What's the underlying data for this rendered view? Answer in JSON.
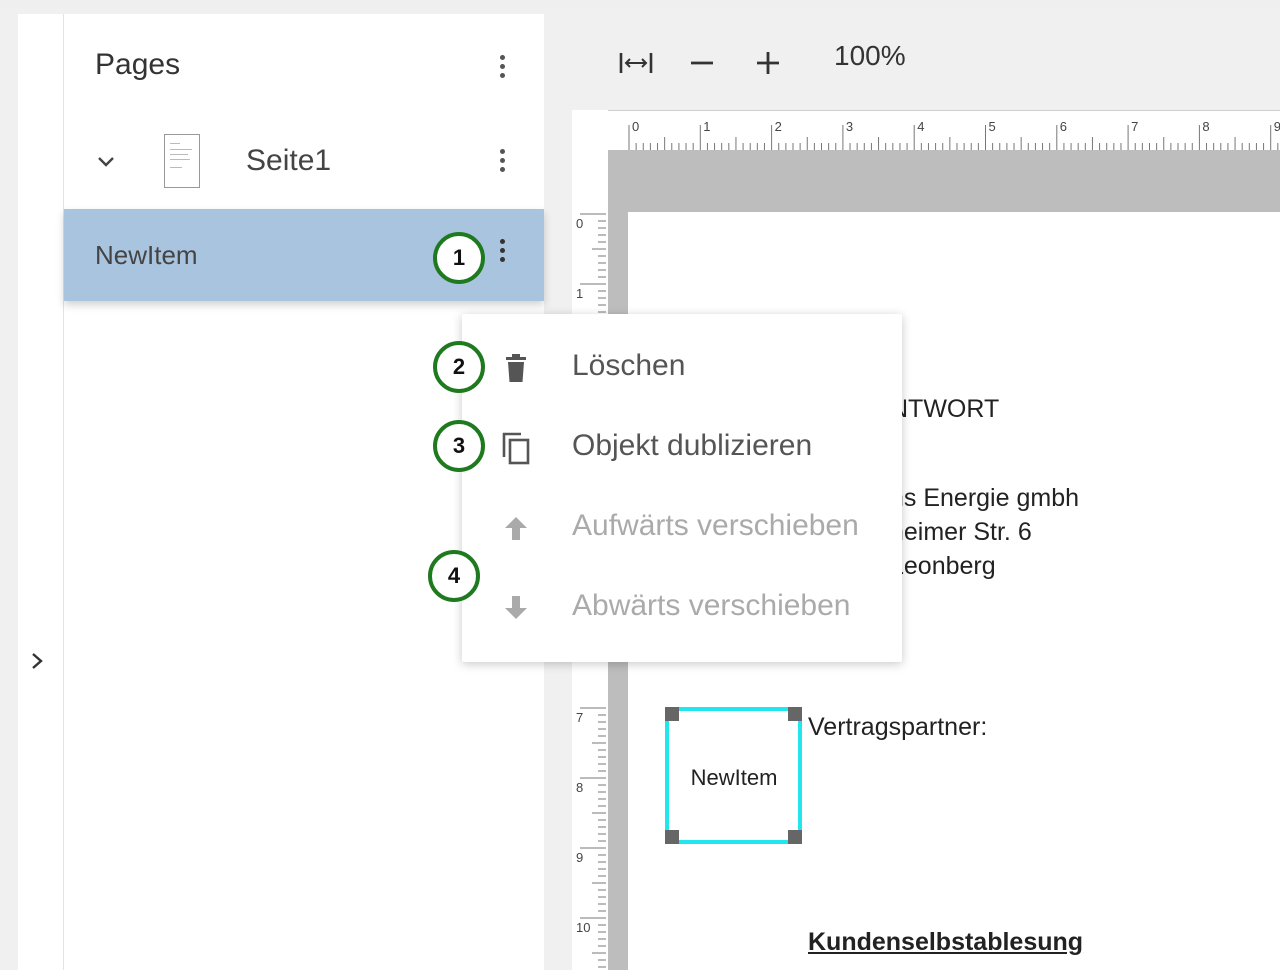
{
  "pages_panel": {
    "title": "Pages",
    "pages": [
      {
        "label": "Seite1",
        "items": [
          {
            "label": "NewItem"
          }
        ]
      }
    ]
  },
  "toolbar": {
    "zoom": "100%"
  },
  "rulers": {
    "horizontal": [
      "0",
      "1",
      "2",
      "3",
      "4",
      "5",
      "6",
      "7",
      "8",
      "9"
    ],
    "vertical": [
      "0",
      "1",
      "7",
      "8",
      "9",
      "10"
    ]
  },
  "document": {
    "lines": [
      "NTWORT",
      "ns Energie gmbh",
      "heimer Str. 6",
      "Leonberg",
      "Vertragspartner:",
      "Kundenselbstablesung"
    ],
    "selected_item": "NewItem",
    "selection_color": "#22e6ee"
  },
  "context_menu": {
    "items": [
      {
        "label": "Löschen",
        "icon": "trash-icon",
        "enabled": true
      },
      {
        "label": "Objekt dublizieren",
        "icon": "copy-icon",
        "enabled": true
      },
      {
        "label": "Aufwärts verschieben",
        "icon": "arrow-up-icon",
        "enabled": false
      },
      {
        "label": "Abwärts verschieben",
        "icon": "arrow-down-icon",
        "enabled": false
      }
    ]
  },
  "annotations": [
    "1",
    "2",
    "3",
    "4"
  ],
  "colors": {
    "selected_row": "#a9c4de",
    "annotation_ring": "#1f7a1f"
  }
}
